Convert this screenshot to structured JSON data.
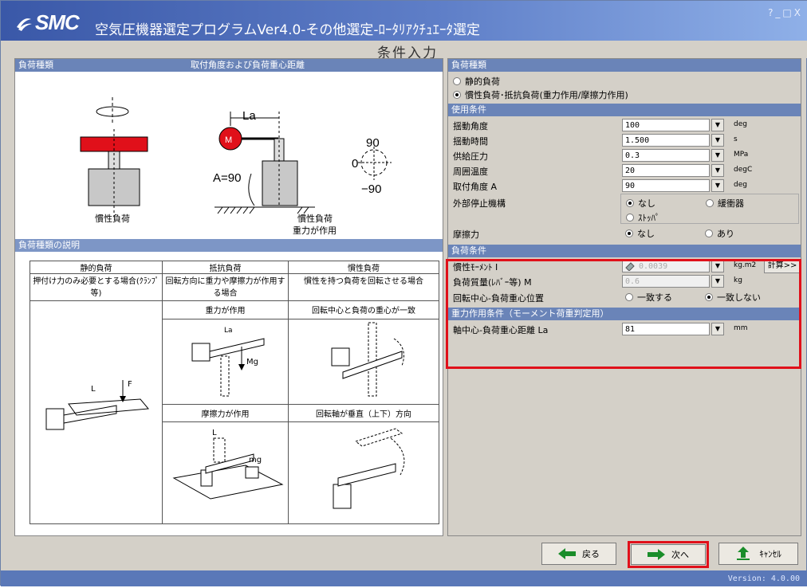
{
  "window": {
    "brand": "SMC",
    "title": "空気圧機器選定プログラムVer4.0-その他選定-ﾛｰﾀﾘｱｸﾁｭｴｰﾀ選定",
    "controls": "?_□X",
    "subtitle": "条件入力",
    "version": "Version: 4.0.00"
  },
  "left_panel": {
    "header_load_type": "負荷種類",
    "header_angle": "取付角度および負荷重心距離",
    "diagram": {
      "label_la": "La",
      "label_m": "M",
      "label_a": "A=90",
      "compass_90": "90",
      "compass_0": "0",
      "compass_neg90": "−90",
      "caption_inertia": "慣性負荷",
      "caption_inertia2_line1": "慣性負荷",
      "caption_inertia2_line2": "重力が作用"
    },
    "explain_header": "負荷種類の説明",
    "table": {
      "col1": "静的負荷",
      "col2": "抵抗負荷",
      "col3": "慣性負荷",
      "desc1": "押付け力のみ必要とする場合(ｸﾗﾝﾌﾟ等)",
      "desc2": "回転方向に重力や摩擦力が作用する場合",
      "desc3": "慣性を持つ負荷を回転させる場合",
      "sub_gravity": "重力が作用",
      "sub_center": "回転中心と負荷の重心が一致",
      "sub_friction": "摩擦力が作用",
      "sub_vertical": "回転軸が垂直（上下）方向",
      "lbl_l": "L",
      "lbl_f": "F",
      "lbl_la": "La",
      "lbl_mg": "Mg",
      "lbl_l2": "L",
      "lbl_mg2": "mg"
    }
  },
  "right_panel": {
    "load_type_header": "負荷種類",
    "load_type_options": [
      "静的負荷",
      "慣性負荷･抵抗負荷(重力作用/摩擦力作用)"
    ],
    "load_type_selected": 1,
    "use_header": "使用条件",
    "use_rows": [
      {
        "label": "揺動角度",
        "value": "100",
        "unit": "deg"
      },
      {
        "label": "揺動時間",
        "value": "1.500",
        "unit": "s"
      },
      {
        "label": "供給圧力",
        "value": "0.3",
        "unit": "MPa"
      },
      {
        "label": "周囲温度",
        "value": "20",
        "unit": "degC"
      },
      {
        "label": "取付角度 A",
        "value": "90",
        "unit": "deg"
      }
    ],
    "stop_label": "外部停止機構",
    "stop_opts": [
      "なし",
      "緩衝器",
      "ｽﾄｯﾊﾟ"
    ],
    "friction_label": "摩擦力",
    "friction_opts": [
      "なし",
      "あり"
    ],
    "load_cond_header": "負荷条件",
    "inertia_label": "慣性ﾓｰﾒﾝﾄ I",
    "inertia_value": "0.0039",
    "inertia_unit": "kg.m2",
    "calc_button": "計算>>",
    "mass_label": "負荷質量(ﾚﾊﾞｰ等) M",
    "mass_value": "0.6",
    "mass_unit": "kg",
    "center_label": "回転中心-負荷重心位置",
    "center_opts": [
      "一致する",
      "一致しない"
    ],
    "gravity_header": "重力作用条件（モーメント荷重判定用）",
    "la_label": "軸中心-負荷重心距離 La",
    "la_value": "81",
    "la_unit": "mm"
  },
  "buttons": {
    "back": "戻る",
    "next": "次へ",
    "cancel": "ｷｬﾝｾﾙ"
  },
  "colors": {
    "accent_red": "#e0101a",
    "header_blue": "#6a84b8",
    "arrow_green": "#1a8d2a"
  }
}
